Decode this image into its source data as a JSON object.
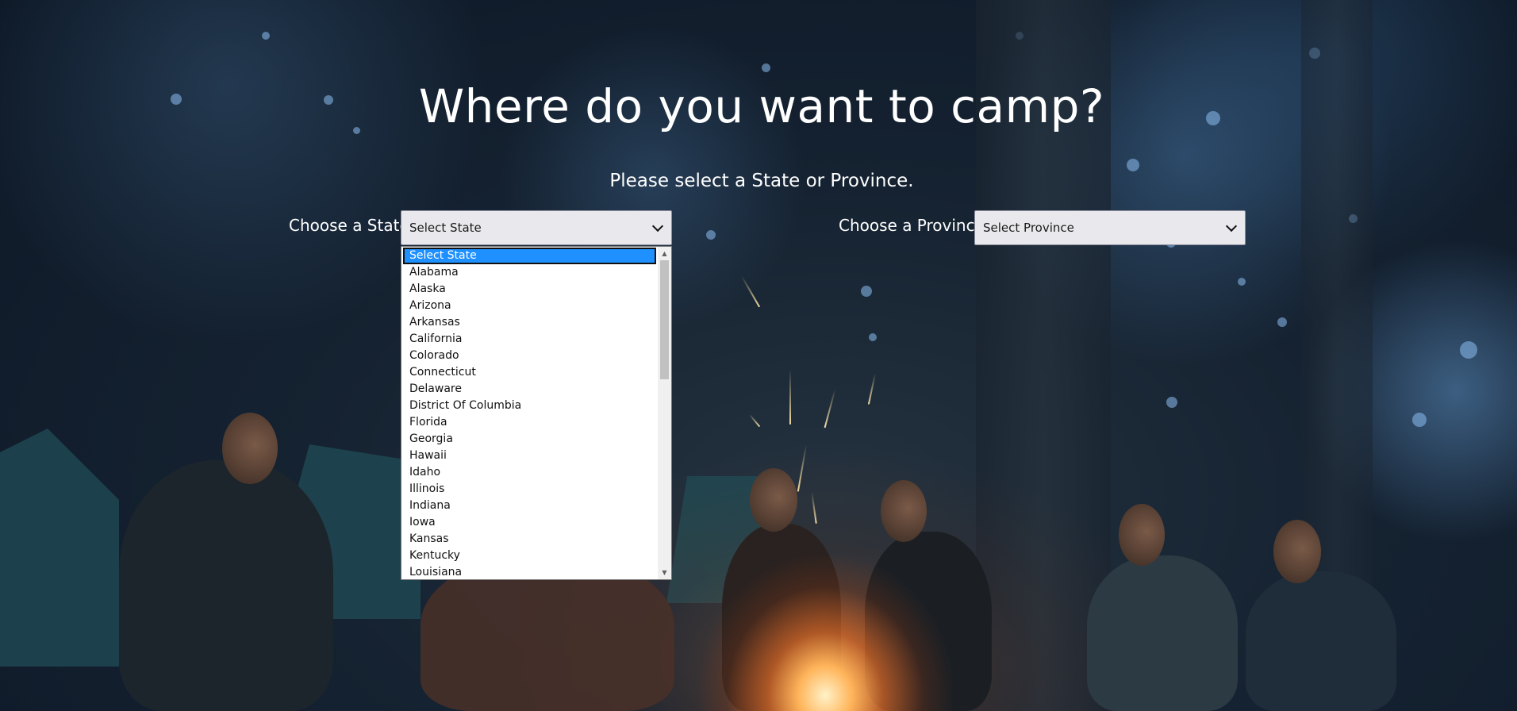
{
  "page": {
    "heading": "Where do you want to camp?",
    "subheading": "Please select a State or Province."
  },
  "state_field": {
    "label": "Choose a State:",
    "selected_value": "Select State",
    "expanded": true,
    "options": [
      "Select State",
      "Alabama",
      "Alaska",
      "Arizona",
      "Arkansas",
      "California",
      "Colorado",
      "Connecticut",
      "Delaware",
      "District Of Columbia",
      "Florida",
      "Georgia",
      "Hawaii",
      "Idaho",
      "Illinois",
      "Indiana",
      "Iowa",
      "Kansas",
      "Kentucky",
      "Louisiana"
    ],
    "highlighted_option": "Select State"
  },
  "province_field": {
    "label": "Choose a Province:",
    "selected_value": "Select Province",
    "expanded": false
  },
  "colors": {
    "text": "#ffffff",
    "select_bg": "#e9e9ed",
    "highlight": "#1e90ff"
  },
  "icons": {
    "select_arrow": "chevron-down-icon",
    "scroll_up": "scroll-up-arrow-icon",
    "scroll_down": "scroll-down-arrow-icon"
  }
}
